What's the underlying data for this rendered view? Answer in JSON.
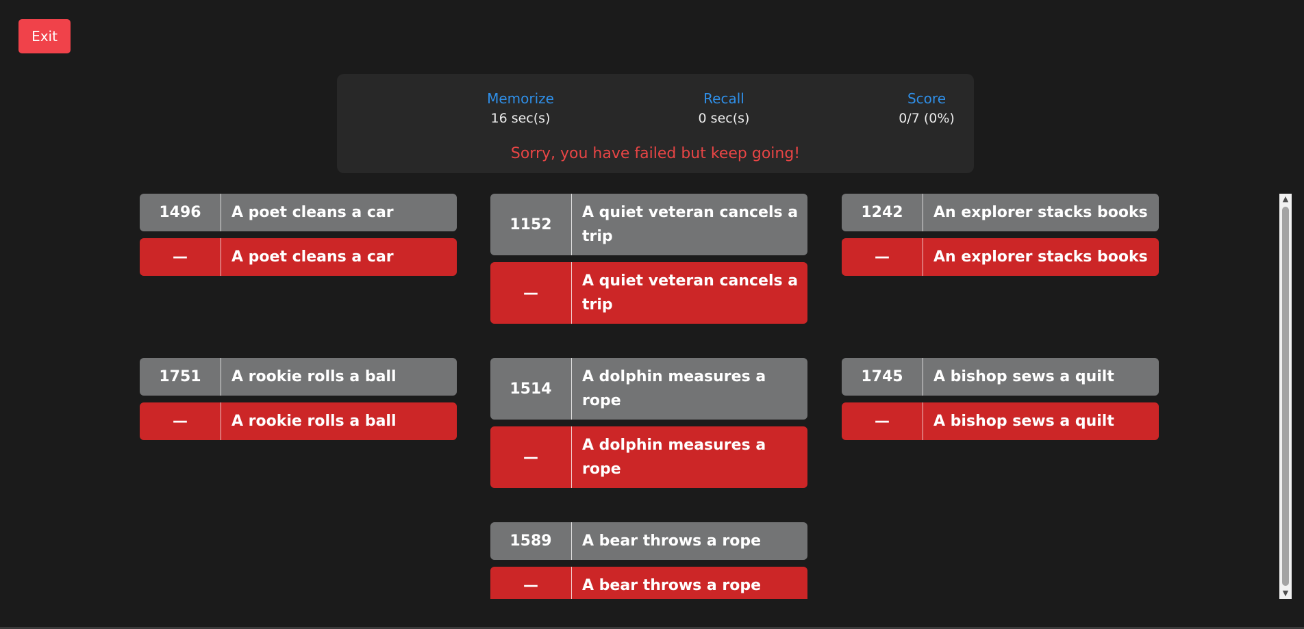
{
  "exit_label": "Exit",
  "stats": {
    "memorize": {
      "label": "Memorize",
      "value": "16 sec(s)"
    },
    "recall": {
      "label": "Recall",
      "value": "0 sec(s)"
    },
    "score": {
      "label": "Score",
      "value": "0/7 (0%)"
    }
  },
  "message": "Sorry, you have failed but keep going!",
  "items": [
    {
      "number": "1496",
      "text": "A poet cleans a car",
      "answer_number": "—",
      "answer_text": "A poet cleans a car"
    },
    {
      "number": "1152",
      "text": "A quiet veteran cancels a trip",
      "answer_number": "—",
      "answer_text": "A quiet veteran cancels a trip"
    },
    {
      "number": "1242",
      "text": "An explorer stacks books",
      "answer_number": "—",
      "answer_text": "An explorer stacks books"
    },
    {
      "number": "1751",
      "text": "A rookie rolls a ball",
      "answer_number": "—",
      "answer_text": "A rookie rolls a ball"
    },
    {
      "number": "1514",
      "text": "A dolphin measures a rope",
      "answer_number": "—",
      "answer_text": "A dolphin measures a rope"
    },
    {
      "number": "1745",
      "text": "A bishop sews a quilt",
      "answer_number": "—",
      "answer_text": "A bishop sews a quilt"
    },
    {
      "number": "1589",
      "text": "A bear throws a rope",
      "answer_number": "—",
      "answer_text": "A bear throws a rope"
    }
  ],
  "scrollbar": {
    "up_icon": "▲",
    "down_icon": "▼"
  },
  "colors": {
    "background": "#1b1b1b",
    "exit_button": "#f0424a",
    "stat_label": "#2f8fe8",
    "fail_message": "#e84545",
    "prompt_cell": "#737475",
    "answer_cell": "#cc2627"
  }
}
